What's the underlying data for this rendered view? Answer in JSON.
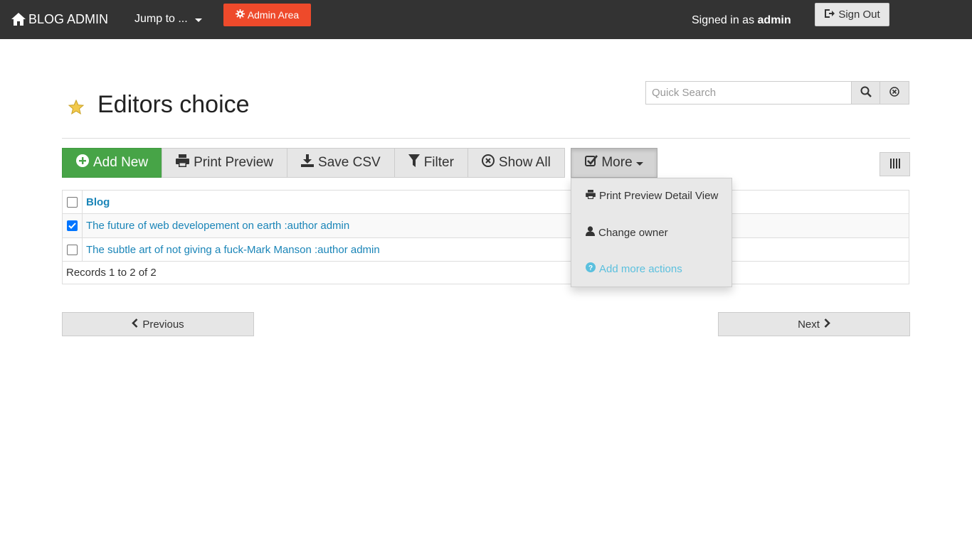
{
  "navbar": {
    "brand": "BLOG ADMIN",
    "jump_to": "Jump to ...",
    "admin_area": "Admin Area",
    "signed_in_prefix": "Signed in as",
    "signed_in_user": "admin",
    "sign_out": "Sign Out"
  },
  "header": {
    "title": "Editors choice",
    "search_placeholder": "Quick Search"
  },
  "toolbar": {
    "add_new": "Add New",
    "print_preview": "Print Preview",
    "save_csv": "Save CSV",
    "filter": "Filter",
    "show_all": "Show All",
    "more": "More"
  },
  "dropdown": {
    "items": [
      {
        "label": "Print Preview Detail View",
        "icon": "print-icon"
      },
      {
        "label": "Change owner",
        "icon": "user-icon"
      },
      {
        "label": "Add more actions",
        "icon": "question-circle-icon"
      }
    ]
  },
  "table": {
    "columns": [
      "Blog"
    ],
    "rows": [
      {
        "blog": "The future of web developement on earth :author admin",
        "checked": true
      },
      {
        "blog": "The subtle art of not giving a fuck-Mark Manson :author admin",
        "checked": false
      }
    ],
    "records": "Records 1 to 2 of 2"
  },
  "pager": {
    "previous": "Previous",
    "next": "Next"
  },
  "colors": {
    "navbar": "#333333",
    "admin_area": "#ee4a2b",
    "add_new": "#47a447",
    "link": "#1a85b8",
    "muted_action": "#5bc0de"
  }
}
